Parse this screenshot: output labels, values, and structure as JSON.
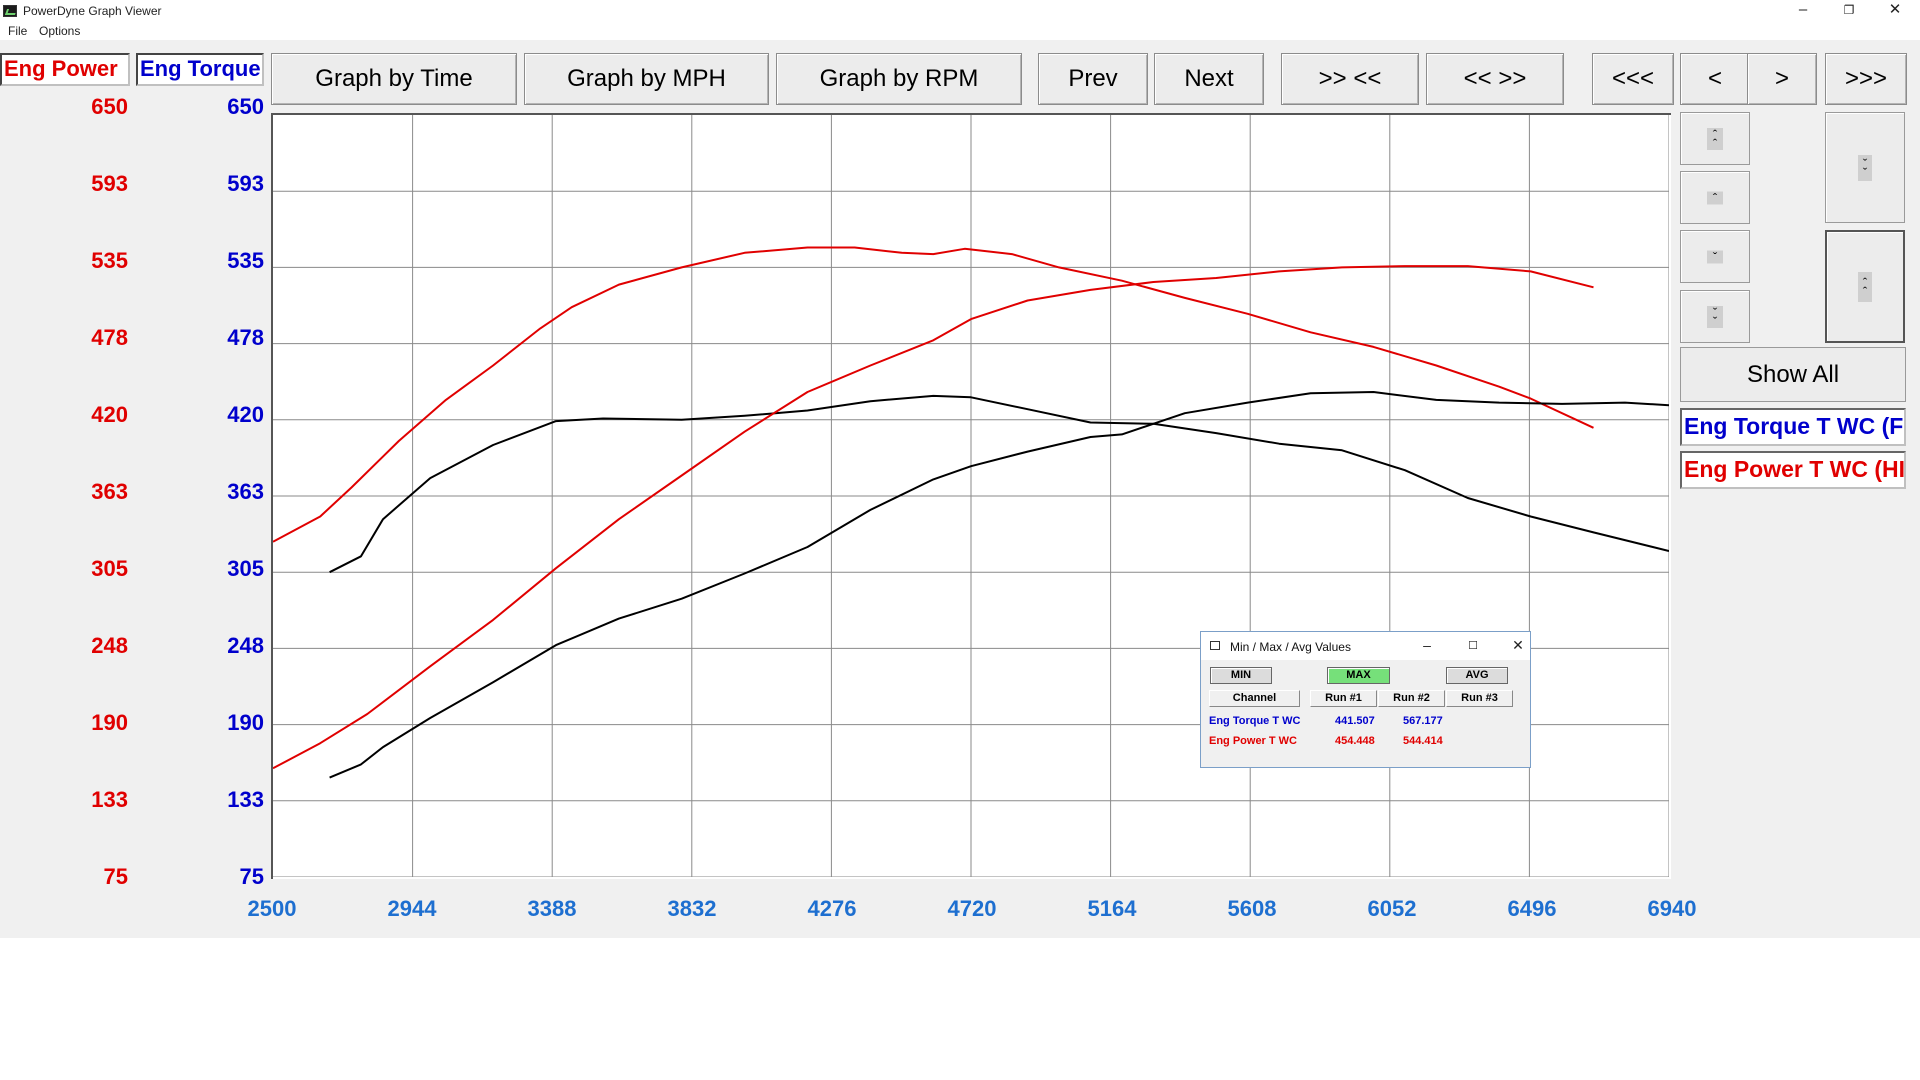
{
  "window": {
    "title": "PowerDyne Graph Viewer",
    "icon": "graph-icon"
  },
  "menu": [
    "File",
    "Options"
  ],
  "legend": {
    "power_label": "Eng Power",
    "torque_label": "Eng Torque"
  },
  "toolbar": {
    "graph_by_time": "Graph by Time",
    "graph_by_mph": "Graph by MPH",
    "graph_by_rpm": "Graph by RPM",
    "prev": "Prev",
    "next": "Next",
    "zoom_in": ">> <<",
    "zoom_out": "<< >>",
    "first": "<<<",
    "back": "<",
    "forward": ">",
    "last": ">>>"
  },
  "side": {
    "show_all": "Show All",
    "channels": [
      "Eng Torque T WC (F",
      "Eng Power T WC (HI"
    ]
  },
  "axes": {
    "left_ticks": [
      "650",
      "593",
      "535",
      "478",
      "420",
      "363",
      "305",
      "248",
      "190",
      "133",
      "75"
    ],
    "right_ticks": [
      "650",
      "593",
      "535",
      "478",
      "420",
      "363",
      "305",
      "248",
      "190",
      "133",
      "75"
    ],
    "x_ticks": [
      "2500",
      "2944",
      "3388",
      "3832",
      "4276",
      "4720",
      "5164",
      "5608",
      "6052",
      "6496",
      "6940"
    ]
  },
  "colors": {
    "power": "#e00000",
    "torque": "#0000cc",
    "x_axis": "#1e6fd0",
    "run1": "#000000",
    "run2": "#e00000"
  },
  "chart_data": {
    "type": "line",
    "xlim": [
      2500,
      6940
    ],
    "ylim": [
      75,
      650
    ],
    "grid": true,
    "series": [
      {
        "channel": "Eng Torque T WC",
        "run": "Run #1",
        "color": "#000000",
        "x": [
          2680,
          2780,
          2850,
          3000,
          3200,
          3400,
          3550,
          3800,
          4000,
          4200,
          4400,
          4600,
          4720,
          4900,
          5100,
          5300,
          5500,
          5700,
          5900,
          6100,
          6300,
          6500,
          6700,
          6940
        ],
        "y": [
          305,
          317,
          345,
          376,
          401,
          419,
          421,
          420,
          423,
          427,
          434,
          438,
          437,
          428,
          418,
          417,
          410,
          402,
          397,
          382,
          361,
          347,
          335,
          321
        ]
      },
      {
        "channel": "Eng Torque T WC",
        "run": "Run #2",
        "color": "#e00000",
        "x": [
          2500,
          2650,
          2750,
          2900,
          3050,
          3200,
          3350,
          3450,
          3600,
          3800,
          4000,
          4200,
          4350,
          4500,
          4600,
          4700,
          4850,
          5000,
          5200,
          5400,
          5600,
          5800,
          6000,
          6200,
          6400,
          6500,
          6700
        ],
        "y": [
          328,
          347,
          369,
          404,
          435,
          461,
          489,
          505,
          522,
          535,
          546,
          550,
          550,
          546,
          545,
          549,
          545,
          535,
          525,
          512,
          500,
          486,
          475,
          461,
          445,
          436,
          414
        ]
      },
      {
        "channel": "Eng Power T WC",
        "run": "Run #1",
        "color": "#000000",
        "x": [
          2680,
          2780,
          2850,
          3000,
          3200,
          3400,
          3600,
          3800,
          4000,
          4200,
          4400,
          4600,
          4720,
          4900,
          5100,
          5200,
          5400,
          5600,
          5800,
          6000,
          6200,
          6400,
          6600,
          6800,
          6940
        ],
        "y": [
          150,
          160,
          173,
          195,
          222,
          250,
          270,
          285,
          304,
          324,
          352,
          375,
          385,
          396,
          407,
          409,
          425,
          433,
          440,
          441,
          435,
          433,
          432,
          433,
          431
        ]
      },
      {
        "channel": "Eng Power T WC",
        "run": "Run #2",
        "color": "#e00000",
        "x": [
          2500,
          2650,
          2800,
          3000,
          3200,
          3400,
          3600,
          3800,
          4000,
          4200,
          4400,
          4600,
          4720,
          4900,
          5100,
          5300,
          5500,
          5700,
          5900,
          6100,
          6300,
          6500,
          6700
        ],
        "y": [
          157,
          176,
          198,
          234,
          269,
          308,
          345,
          378,
          411,
          441,
          461,
          480,
          496,
          510,
          518,
          524,
          527,
          532,
          535,
          536,
          536,
          532,
          520
        ]
      }
    ]
  },
  "popup": {
    "title": "Min / Max / Avg Values",
    "buttons": {
      "min": "MIN",
      "max": "MAX",
      "avg": "AVG"
    },
    "active_color": "#76e07a",
    "headers": [
      "Channel",
      "Run #1",
      "Run #2",
      "Run #3"
    ],
    "rows": [
      {
        "channel": "Eng Torque T WC",
        "run1": "441.507",
        "run2": "567.177",
        "run3": "",
        "color": "#0000cc"
      },
      {
        "channel": "Eng Power T WC",
        "run1": "454.448",
        "run2": "544.414",
        "run3": "",
        "color": "#e00000"
      }
    ]
  }
}
